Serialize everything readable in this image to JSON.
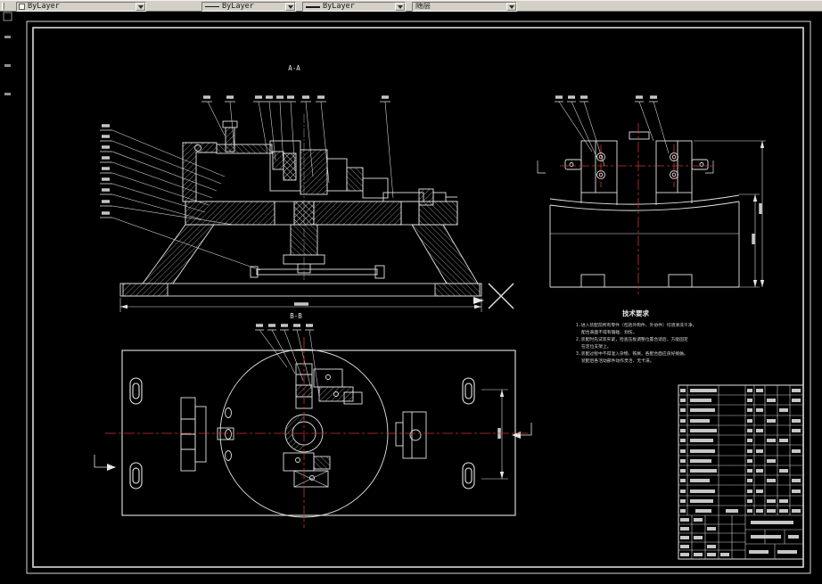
{
  "toolbar": {
    "color_label": "ByLayer",
    "linetype_label": "ByLayer",
    "lineweight_label": "ByLayer",
    "plotstyle_label": "随层"
  },
  "drawing": {
    "section_label_top": "A-A",
    "section_label_bottom": "B-B",
    "tech": {
      "title": "技术要求",
      "line1": "1.进入装配前所有零件（包括外购件、外协件）均须清洗干净，",
      "line2": "配合表面不得有磕碰、划伤。",
      "line3": "2.装配时先试装夹紧，检查压板调整位置合适后，方能固定",
      "line4": "在定位支架上。",
      "line5": "3.装配过程中不得混入杂物、铁屑，各配合面应良好接触。",
      "line6": "装配后各活动部件动作灵活、无卡滞。"
    }
  }
}
